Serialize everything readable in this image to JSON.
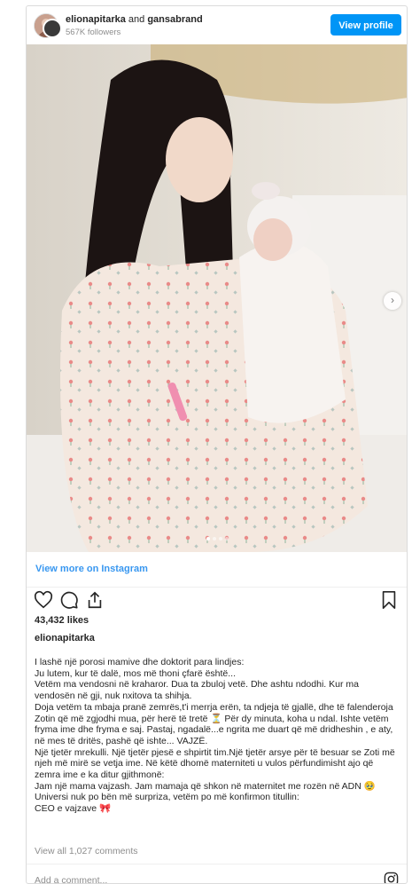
{
  "post": {
    "header": {
      "author": "elionapitarka",
      "and_text": " and ",
      "coauthor": "gansabrand",
      "followers": "567K followers",
      "view_profile_label": "View profile"
    },
    "carousel": {
      "slide_count": 4,
      "active_index": 0
    },
    "view_more_label": "View more on Instagram",
    "likes": "43,432 likes",
    "caption_username": "elionapitarka",
    "caption_lines": [
      "I lashë një porosi mamive dhe doktorit para lindjes:",
      "Ju lutem, kur të dalë, mos më thoni çfarë është...",
      "Vetëm ma vendosni në kraharor. Dua ta zbuloj vetë. Dhe ashtu ndodhi. Kur ma vendosën në gji, nuk nxitova ta shihja.",
      "Doja vetëm ta mbaja pranë zemrës,t'i merrja erën, ta ndjeja të gjallë, dhe të falenderoja Zotin që më zgjodhi mua, për herë të tretë ⏳ Për dy minuta, koha u ndal. Ishte vetëm fryma ime dhe fryma e saj. Pastaj, ngadalë...e ngrita me duart që më dridheshin , e aty, në mes të dritës, pashë që ishte... VAJZË.",
      "Një tjetër mrekulli. Një tjetër pjesë e shpirtit tim.Një tjetër arsye për të besuar se Zoti më njeh më mirë se vetja ime. Në këtë dhomë materniteti u vulos përfundimisht ajo që zemra ime e ka ditur gjithmonë:",
      "Jam një mama vajzash. Jam mamaja që shkon në maternitet me rozën në ADN 🥹",
      "Universi nuk po bën më surpriza, vetëm po më konfirmon titullin:",
      "CEO e vajzave 🎀"
    ],
    "view_all_comments": "View all 1,027 comments",
    "add_comment_placeholder": "Add a comment...",
    "icons": [
      "heart-icon",
      "comment-icon",
      "share-icon",
      "bookmark-icon",
      "instagram-icon",
      "chevron-right-icon"
    ],
    "colors": {
      "accent": "#0095f6",
      "link": "#3897f0",
      "muted": "#8e8e8e",
      "text": "#262626"
    }
  }
}
